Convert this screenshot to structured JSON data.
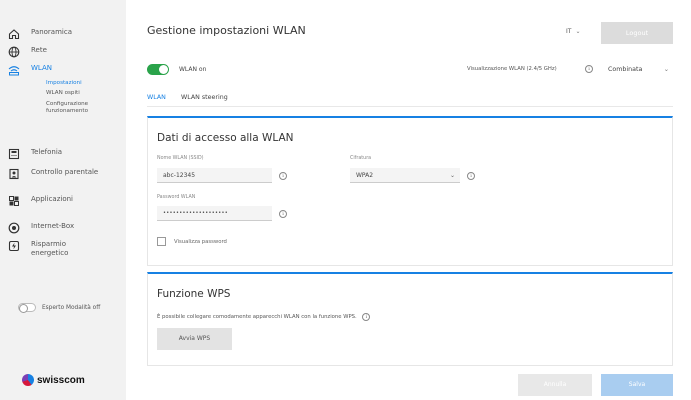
{
  "sidebar": {
    "items": [
      {
        "label": "Panoramica",
        "icon": "home-icon"
      },
      {
        "label": "Rete",
        "icon": "globe-icon"
      },
      {
        "label": "WLAN",
        "icon": "wifi-icon"
      },
      {
        "label": "Telefonia",
        "icon": "phone-icon"
      },
      {
        "label": "Controllo parentale",
        "icon": "parental-control-icon"
      },
      {
        "label": "Applicazioni",
        "icon": "apps-icon"
      },
      {
        "label": "Internet-Box",
        "icon": "box-icon"
      },
      {
        "label": "Risparmio energetico",
        "icon": "energy-icon"
      }
    ],
    "sub_items": [
      {
        "label": "Impostazioni"
      },
      {
        "label": "WLAN ospiti"
      },
      {
        "label": "Configurazione funzionamento"
      }
    ],
    "expert_mode_label": "Esperto Modalità off",
    "logo_text": "swisscom"
  },
  "header": {
    "title": "Gestione impostazioni WLAN",
    "language": "IT",
    "logout_label": "Logout"
  },
  "wlan": {
    "toggle_label": "WLAN on",
    "toggle_on": true,
    "band_label": "Visualizzazione WLAN (2.4/5 GHz)",
    "band_value": "Combinata"
  },
  "tabs": [
    {
      "label": "WLAN",
      "active": true
    },
    {
      "label": "WLAN steering",
      "active": false
    }
  ],
  "access_card": {
    "title": "Dati di accesso alla WLAN",
    "ssid_label": "Nome WLAN (SSID)",
    "ssid_value": "abc-12345",
    "encryption_label": "Cifratura",
    "encryption_value": "WPA2",
    "password_label": "Password WLAN",
    "password_value": "••••••••••••••••••••",
    "show_password_label": "Visualizza password"
  },
  "wps_card": {
    "title": "Funzione WPS",
    "description": "È possibile collegare comodamente apparecchi WLAN con la funzione WPS.",
    "button_label": "Avvia WPS"
  },
  "footer": {
    "cancel_label": "Annulla",
    "save_label": "Salva"
  },
  "colors": {
    "accent": "#1781e3",
    "toggle_on": "#2aa34a",
    "sidebar_bg": "#f2f2f2"
  }
}
